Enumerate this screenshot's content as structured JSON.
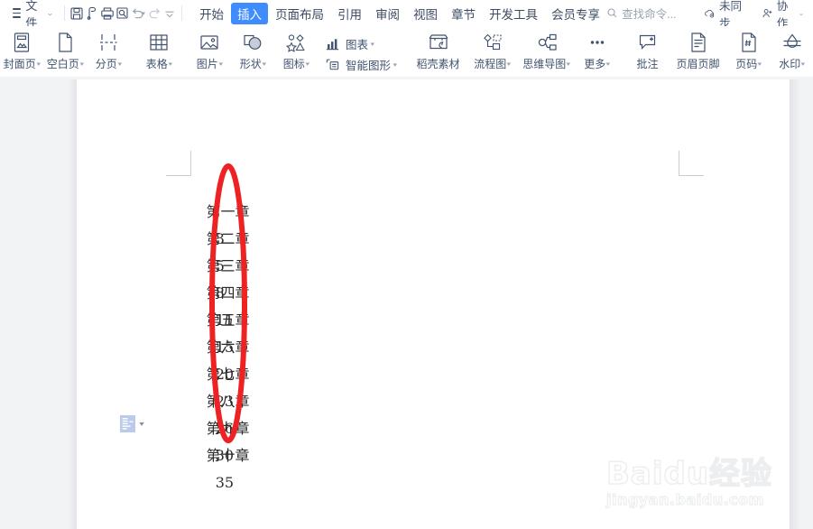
{
  "titlebar": {
    "file_menu": "文件",
    "quick_access": [
      {
        "name": "save-icon",
        "tip": "保存"
      },
      {
        "name": "print-preview-icon",
        "tip": "打印预览"
      },
      {
        "name": "print-icon",
        "tip": "打印"
      },
      {
        "name": "search-doc-icon",
        "tip": "查找"
      },
      {
        "name": "undo-icon",
        "tip": "撤销"
      },
      {
        "name": "redo-icon",
        "tip": "重做"
      },
      {
        "name": "customize-toolbar-icon",
        "tip": "自定义快速访问工具栏"
      }
    ],
    "tabs": [
      {
        "label": "开始",
        "active": false
      },
      {
        "label": "插入",
        "active": true
      },
      {
        "label": "页面布局",
        "active": false
      },
      {
        "label": "引用",
        "active": false
      },
      {
        "label": "审阅",
        "active": false
      },
      {
        "label": "视图",
        "active": false
      },
      {
        "label": "章节",
        "active": false
      },
      {
        "label": "开发工具",
        "active": false
      },
      {
        "label": "会员专享",
        "active": false
      }
    ],
    "search": {
      "placeholder": "查找命令...",
      "icon": "search-icon"
    },
    "sync": {
      "label": "未同步",
      "icon": "cloud-sync-icon"
    },
    "collab": {
      "label": "协作",
      "icon": "user-add-icon"
    },
    "accent": "#3f8cff"
  },
  "ribbon": {
    "groups": [
      {
        "items": [
          {
            "label": "封面页",
            "icon": "cover-page-icon",
            "dropdown": true
          },
          {
            "label": "空白页",
            "icon": "blank-page-icon",
            "dropdown": true
          },
          {
            "label": "分页",
            "icon": "page-break-icon",
            "dropdown": true
          }
        ]
      },
      {
        "items": [
          {
            "label": "表格",
            "icon": "table-icon",
            "dropdown": true
          }
        ]
      },
      {
        "items": [
          {
            "label": "图片",
            "icon": "picture-icon",
            "dropdown": true
          },
          {
            "label": "形状",
            "icon": "shapes-icon",
            "dropdown": true
          },
          {
            "label": "图标",
            "icon": "icons-icon",
            "dropdown": true
          }
        ],
        "stacked": [
          {
            "label": "图表",
            "icon": "chart-icon",
            "dropdown": true
          },
          {
            "label": "智能图形",
            "icon": "smartart-icon",
            "dropdown": true
          }
        ]
      },
      {
        "items": [
          {
            "label": "稻壳素材",
            "icon": "docer-store-icon",
            "dropdown": false
          },
          {
            "label": "流程图",
            "icon": "flowchart-icon",
            "dropdown": true
          },
          {
            "label": "思维导图",
            "icon": "mindmap-icon",
            "dropdown": true
          },
          {
            "label": "更多",
            "icon": "more-icon",
            "dropdown": true
          }
        ]
      },
      {
        "items": [
          {
            "label": "批注",
            "icon": "comment-icon",
            "dropdown": false
          },
          {
            "label": "页眉页脚",
            "icon": "header-footer-icon",
            "dropdown": false
          },
          {
            "label": "页码",
            "icon": "page-number-icon",
            "dropdown": true
          },
          {
            "label": "水印",
            "icon": "watermark-icon",
            "dropdown": true
          }
        ]
      }
    ]
  },
  "document": {
    "lines": [
      {
        "chapter": "第一章",
        "page": "3"
      },
      {
        "chapter": "第二章",
        "page": "5"
      },
      {
        "chapter": "第三章",
        "page": "8"
      },
      {
        "chapter": "第四章",
        "page": "11"
      },
      {
        "chapter": "第五章",
        "page": "15"
      },
      {
        "chapter": "第六章",
        "page": "20"
      },
      {
        "chapter": "第七章",
        "page": "23"
      },
      {
        "chapter": "第八章",
        "page": "26"
      },
      {
        "chapter": "第九章",
        "page": "30"
      },
      {
        "chapter": "第十章",
        "page": "35"
      }
    ],
    "smart_tag": {
      "name": "paste-options-icon"
    },
    "annotation": {
      "shape": "ellipse",
      "color": "#ee2222"
    }
  },
  "watermark": {
    "brand": "Baidu经验",
    "brand_prefix": "Bai",
    "brand_mid": "du",
    "brand_suffix": "经验",
    "url": "jingyan.baidu.com"
  }
}
